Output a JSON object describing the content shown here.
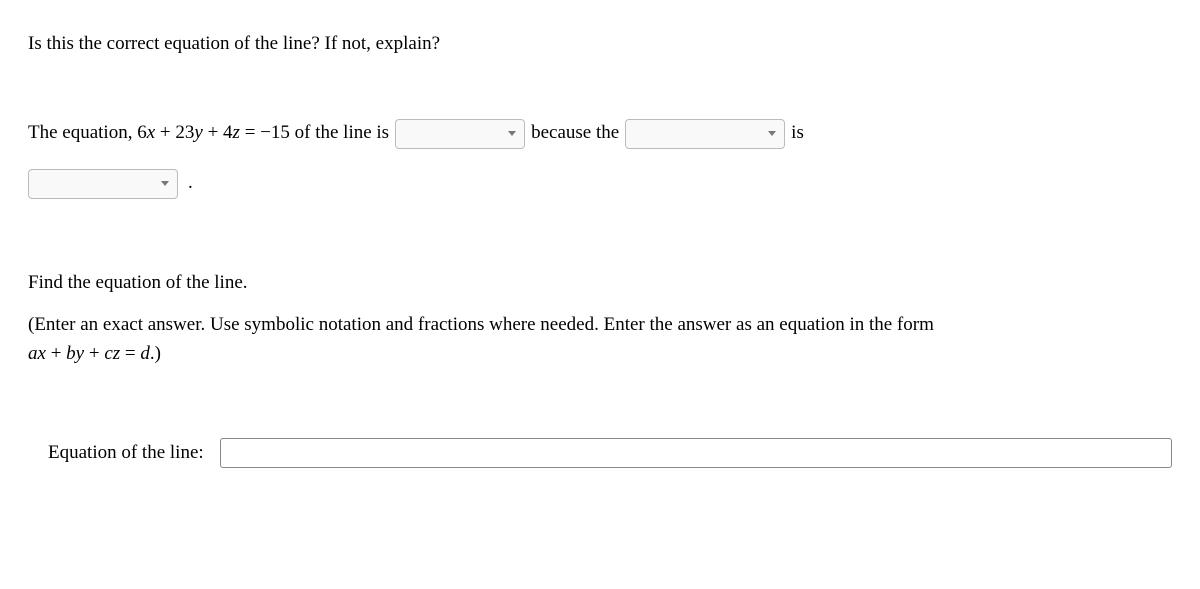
{
  "question": {
    "prompt": "Is this the correct equation of the line? If not, explain?"
  },
  "fill": {
    "prefix": "The equation, ",
    "eq_6": "6",
    "eq_x": "x",
    "eq_plus1": " + ",
    "eq_23": "23",
    "eq_y": "y",
    "eq_plus2": " + ",
    "eq_4": "4",
    "eq_z": "z",
    "eq_eq": " = ",
    "eq_rhs": "−15",
    "suffix1": " of the line is ",
    "mid1": " because the ",
    "mid2": " is",
    "period": "."
  },
  "section2": {
    "prompt": "Find the equation of the line.",
    "help_open": "(Enter an exact answer. Use symbolic notation and fractions where needed. Enter the answer as an equation in the form",
    "form_a": "a",
    "form_x": "x",
    "form_p1": " + ",
    "form_b": "b",
    "form_y": "y",
    "form_p2": " + ",
    "form_c": "c",
    "form_z": "z",
    "form_eq": " = ",
    "form_d": "d",
    "help_close": ".)",
    "answer_label": "Equation of the line:"
  }
}
